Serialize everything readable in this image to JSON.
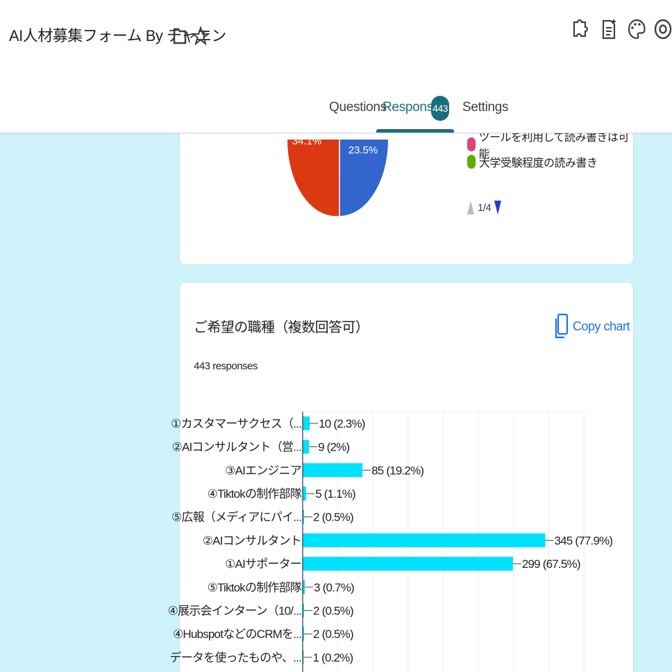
{
  "header": {
    "form_title": "AI人材募集フォーム By チャエン",
    "title_icons": [
      "folder-icon",
      "star-icon"
    ],
    "toolbar_icons": [
      "puzzle-icon",
      "add-note-icon",
      "palette-icon",
      "preview-icon"
    ]
  },
  "tabs": [
    {
      "label": "Questions",
      "active": false
    },
    {
      "label": "Responses",
      "active": true,
      "badge": "443"
    },
    {
      "label": "Settings",
      "active": false
    }
  ],
  "colors": {
    "accent": "#1a6e7c",
    "page_bg": "#cff3fb",
    "bar": "#00e0ff",
    "pie_red": "#dc3912",
    "pie_blue": "#3366cc",
    "legend_pink": "#dd4477",
    "legend_green": "#66aa00",
    "link": "#1a73e8"
  },
  "pie_card": {
    "slice_labels": [
      "34.1%",
      "23.5%"
    ],
    "legend": [
      {
        "label": "ツールを利用して読み書きは可能",
        "color": "#dd4477"
      },
      {
        "label": "大学受験程度の読み書き",
        "color": "#66aa00"
      }
    ],
    "pager": "1/4"
  },
  "question_card": {
    "title": "ご希望の職種（複数回答可）",
    "responses": "443 responses",
    "copy_label": "Copy chart",
    "copy_icon": "copy-icon"
  },
  "chart_data": {
    "type": "bar",
    "orientation": "horizontal",
    "title": "",
    "xlim": [
      0,
      400
    ],
    "grid": true,
    "categories": [
      "①カスタマーサクセス（...",
      "②AIコンサルタント（営...",
      "③AIエンジニア",
      "④Tiktokの制作部隊",
      "⑤広報（メディアにパイ...",
      "②AIコンサルタント",
      "①AIサポーター",
      "⑤Tiktokの制作部隊",
      "④展示会インターン（10/...",
      "④HubspotなどのCRMを...",
      "データを使ったものや、..."
    ],
    "values": [
      10,
      9,
      85,
      5,
      2,
      345,
      299,
      3,
      2,
      2,
      1
    ],
    "value_labels": [
      "10 (2.3%)",
      "9 (2%)",
      "85 (19.2%)",
      "5 (1.1%)",
      "2 (0.5%)",
      "345 (77.9%)",
      "299 (67.5%)",
      "3 (0.7%)",
      "2 (0.5%)",
      "2 (0.5%)",
      "1 (0.2%)"
    ]
  }
}
